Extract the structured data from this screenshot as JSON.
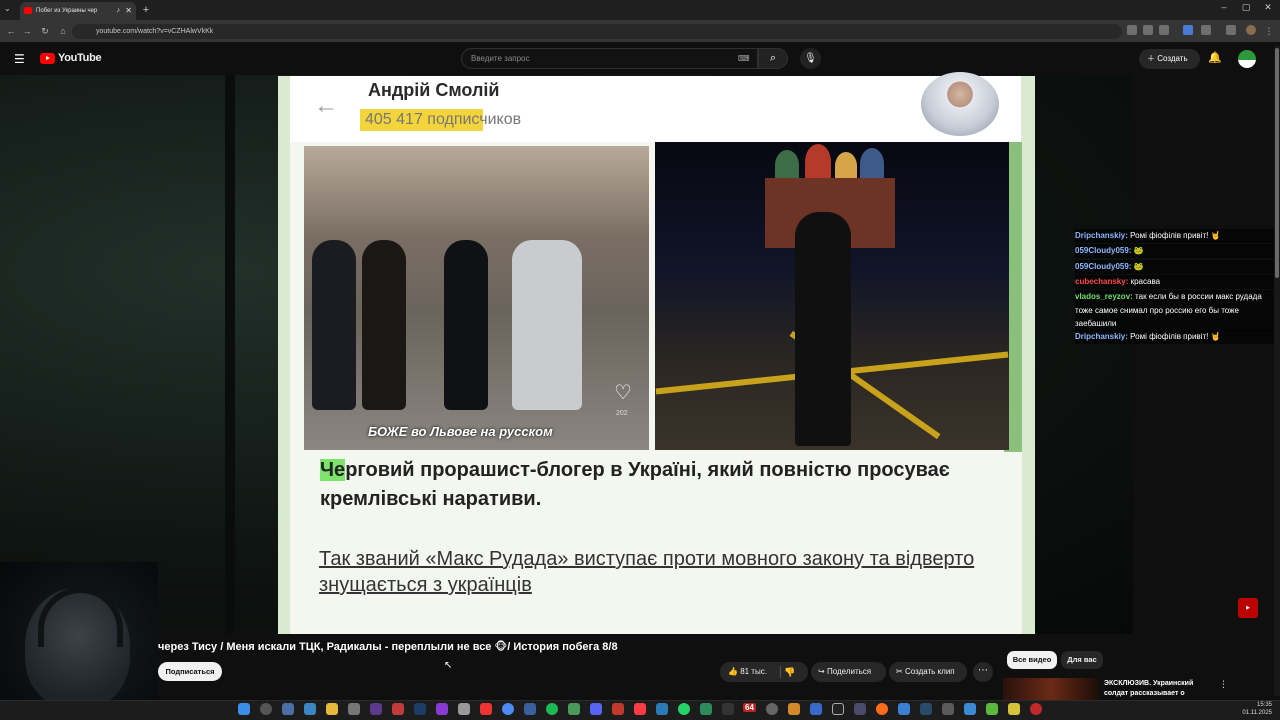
{
  "browser": {
    "tab_title": "Побег из Украины чер",
    "url": "youtube.com/watch?v=vCZHAlwVkKk"
  },
  "youtube": {
    "logo_text": "YouTube",
    "search_placeholder": "Введите запрос",
    "create_label": "Создать"
  },
  "video_frame": {
    "author": "Андрій Смолій",
    "subscribers": "405 417 подписчиков",
    "image_caption": "БОЖЕ во Львове на русском",
    "like_count_small": "202",
    "text_highlight": "Че",
    "text_main": "рговий прорашист-блогер в Україні, який повністю просуває кремлівські наративи.",
    "text_link": "Так званий «Макс Рудада» виступає проти мовного закону та відверто знущається з українців"
  },
  "chat": [
    {
      "name": "Dripchanskiy:",
      "text": "Ромі фіофілів привіт! 🤘",
      "color": "#8fb6ff"
    },
    {
      "name": "059Cloudy059:",
      "text": "🐸",
      "color": "#8fb6ff"
    },
    {
      "name": "059Cloudy059:",
      "text": "🐸",
      "color": "#8fb6ff"
    },
    {
      "name": "cubechansky:",
      "text": "красава",
      "color": "#ff4a4a"
    },
    {
      "name": "vlados_reyzov:",
      "text": "так если бы в россии макс рудада тоже самое снимал про россию его бы тоже заебашили",
      "color": "#6fe06f"
    },
    {
      "name": "Dripchanskiy:",
      "text": "Ромі фіофілів привіт! 🤘",
      "color": "#8fb6ff"
    }
  ],
  "video": {
    "title": "через Тису / Меня искали ТЦК, Радикалы - переплыли не все 🐵/ История побега 8/8",
    "subscribe_label": "Подписаться",
    "likes": "81 тыс.",
    "share_label": "Поделиться",
    "clip_label": "Создать клип"
  },
  "sidebar": {
    "chips": [
      "Все видео",
      "Для вас"
    ],
    "rec_title": "ЭКСКЛЮЗИВ. Украинский солдат рассказывает о"
  },
  "taskbar": {
    "time": "15:35",
    "date": "01.11.2025",
    "badge_count": "64"
  },
  "colors": {
    "accent": "#ff0000",
    "highlight": "#f3d43a",
    "text_highlight": "#7de36a"
  }
}
